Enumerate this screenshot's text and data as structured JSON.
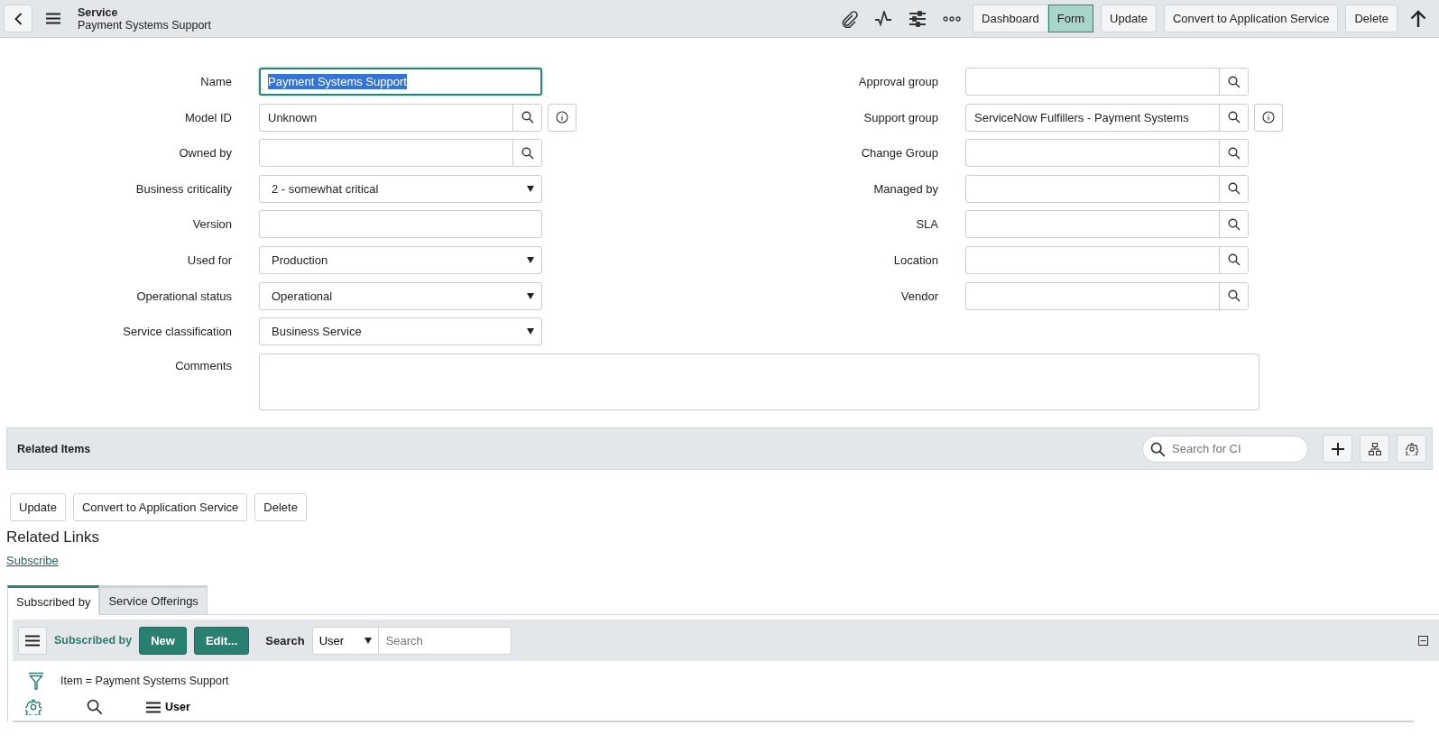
{
  "header": {
    "record_type": "Service",
    "record_name": "Payment Systems Support",
    "view_toggle": [
      {
        "label": "Dashboard",
        "selected": false
      },
      {
        "label": "Form",
        "selected": true
      }
    ],
    "actions": [
      "Update",
      "Convert to Application Service",
      "Delete"
    ]
  },
  "form": {
    "left_fields": [
      {
        "label": "Name",
        "kind": "text",
        "value": "Payment Systems Support",
        "focused": true
      },
      {
        "label": "Model ID",
        "kind": "lookup_info",
        "value": "Unknown",
        "focused": false
      },
      {
        "label": "Owned by",
        "kind": "lookup",
        "focused": false
      },
      {
        "label": "Business criticality",
        "kind": "choice",
        "value": "2 - somewhat critical",
        "focused": false
      },
      {
        "label": "Version",
        "kind": "text",
        "focused": false
      },
      {
        "label": "Used for",
        "kind": "choice",
        "value": "Production",
        "focused": false
      },
      {
        "label": "Operational status",
        "kind": "choice",
        "value": "Operational",
        "focused": false
      },
      {
        "label": "Service classification",
        "kind": "choice",
        "value": "Business Service",
        "focused": false
      }
    ],
    "right_fields": [
      {
        "label": "Approval group",
        "kind": "lookup",
        "focused": false
      },
      {
        "label": "Support group",
        "kind": "lookup_info",
        "value": "ServiceNow Fulfillers - Payment Systems",
        "focused": false
      },
      {
        "label": "Change Group",
        "kind": "lookup",
        "focused": false
      },
      {
        "label": "Managed by",
        "kind": "lookup",
        "focused": false
      },
      {
        "label": "SLA",
        "kind": "lookup",
        "focused": false
      },
      {
        "label": "Location",
        "kind": "lookup",
        "focused": false
      },
      {
        "label": "Vendor",
        "kind": "lookup",
        "focused": false
      }
    ],
    "comments": {
      "label": "Comments"
    }
  },
  "related_items": {
    "title": "Related Items",
    "search": {
      "placeholder": "Search for CI"
    }
  },
  "bottom_actions": [
    "Update",
    "Convert to Application Service",
    "Delete"
  ],
  "related_links": {
    "title": "Related Links",
    "links": [
      "Subscribe"
    ]
  },
  "related_lists": {
    "tabs": [
      {
        "label": "Subscribed by",
        "selected": true
      },
      {
        "label": "Service Offerings",
        "selected": false
      }
    ],
    "toolbar": {
      "title": "Subscribed by",
      "buttons": [
        "New",
        "Edit..."
      ],
      "search_label": "Search",
      "search_field": "User",
      "search": {
        "placeholder": "Search"
      }
    },
    "filter": "Item = Payment Systems Support",
    "columns": [
      "User"
    ]
  }
}
